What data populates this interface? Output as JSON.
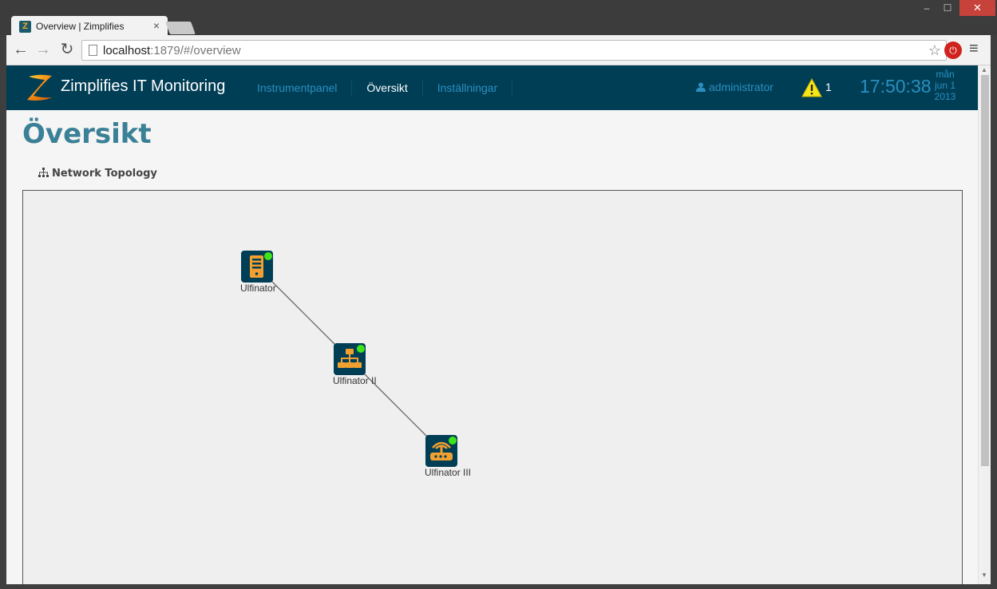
{
  "browser": {
    "tab_title": "Overview | Zimplifies",
    "tab_close": "×",
    "url_host": "localhost",
    "url_rest": ":1879/#/overview",
    "window_controls": {
      "minimize": "–",
      "maximize": "☐",
      "close": "✕"
    },
    "nav": {
      "back": "←",
      "forward": "→",
      "reload": "↻"
    },
    "star": "☆",
    "menu": "≡"
  },
  "app": {
    "brand": "Zimplifies IT Monitoring",
    "menu": [
      {
        "label": "Instrumentpanel",
        "active": false
      },
      {
        "label": "Översikt",
        "active": true
      },
      {
        "label": "Inställningar",
        "active": false
      }
    ],
    "user": "administrator",
    "alert_count": "1",
    "clock": "17:50:38",
    "date": {
      "day": "mån",
      "daymonth": "jun 1",
      "year": "2013"
    },
    "colors": {
      "navbar": "#003e56",
      "link": "#2a8fc0",
      "title": "#3a8096",
      "status_online": "#3ee31a",
      "device_accent": "#f0a030"
    }
  },
  "page": {
    "title": "Översikt",
    "section_tab": "Network Topology"
  },
  "topology": {
    "nodes": [
      {
        "id": "n1",
        "label": "Ulfinator",
        "icon": "server-icon",
        "status": "online"
      },
      {
        "id": "n2",
        "label": "Ulfinator II",
        "icon": "switch-icon",
        "status": "online"
      },
      {
        "id": "n3",
        "label": "Ulfinator III",
        "icon": "router-icon",
        "status": "online"
      }
    ],
    "edges": [
      {
        "from": "n1",
        "to": "n2"
      },
      {
        "from": "n2",
        "to": "n3"
      }
    ]
  }
}
